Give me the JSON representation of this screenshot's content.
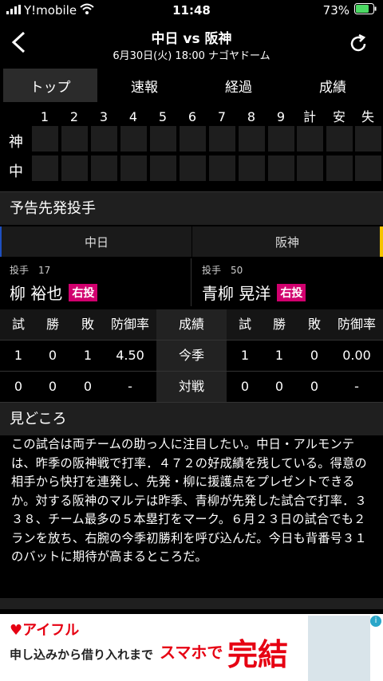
{
  "status": {
    "carrier": "Y!mobile",
    "time": "11:48",
    "battery": "73%"
  },
  "header": {
    "title": "中日 vs 阪神",
    "subtitle": "6月30日(火) 18:00 ナゴヤドーム"
  },
  "tabs": [
    "トップ",
    "速報",
    "経過",
    "成績"
  ],
  "scoreboard": {
    "columns": [
      "1",
      "2",
      "3",
      "4",
      "5",
      "6",
      "7",
      "8",
      "9",
      "計",
      "安",
      "失"
    ],
    "teams": [
      "神",
      "中"
    ]
  },
  "probable": {
    "title": "予告先発投手",
    "home_team": "中日",
    "away_team": "阪神",
    "home_pitcher": {
      "meta": "投手　17",
      "name": "柳 裕也",
      "hand": "右投"
    },
    "away_pitcher": {
      "meta": "投手　50",
      "name": "青柳 晃洋",
      "hand": "右投"
    }
  },
  "stats": {
    "headers": [
      "試",
      "勝",
      "敗",
      "防御率"
    ],
    "center_header": "成績",
    "rows": [
      {
        "label": "今季",
        "home": [
          "1",
          "0",
          "1",
          "4.50"
        ],
        "away": [
          "1",
          "1",
          "0",
          "0.00"
        ]
      },
      {
        "label": "対戦",
        "home": [
          "0",
          "0",
          "0",
          "-"
        ],
        "away": [
          "0",
          "0",
          "0",
          "-"
        ]
      }
    ]
  },
  "highlight": {
    "title": "見どころ",
    "text": "この試合は両チームの助っ人に注目したい。中日・アルモンテは、昨季の阪神戦で打率．４７２の好成績を残している。得意の相手から快打を連発し、先発・柳に援護点をプレゼントできるか。対する阪神のマルテは昨季、青柳が先発した試合で打率．３３８、チーム最多の５本塁打をマーク。６月２３日の試合でも２ランを放ち、右腕の今季初勝利を呼び込んだ。今日も背番号３１のバットに期待が高まるところだ。"
  },
  "ad": {
    "logo": "アイフル",
    "copy1": "申し込みから借り入れまで",
    "copy2": "スマホで",
    "copy3": "完結"
  },
  "colors": {
    "accent_home": "#1e4fbf",
    "accent_away": "#f5c400",
    "badge": "#d1006e",
    "ad_red": "#e60012"
  }
}
